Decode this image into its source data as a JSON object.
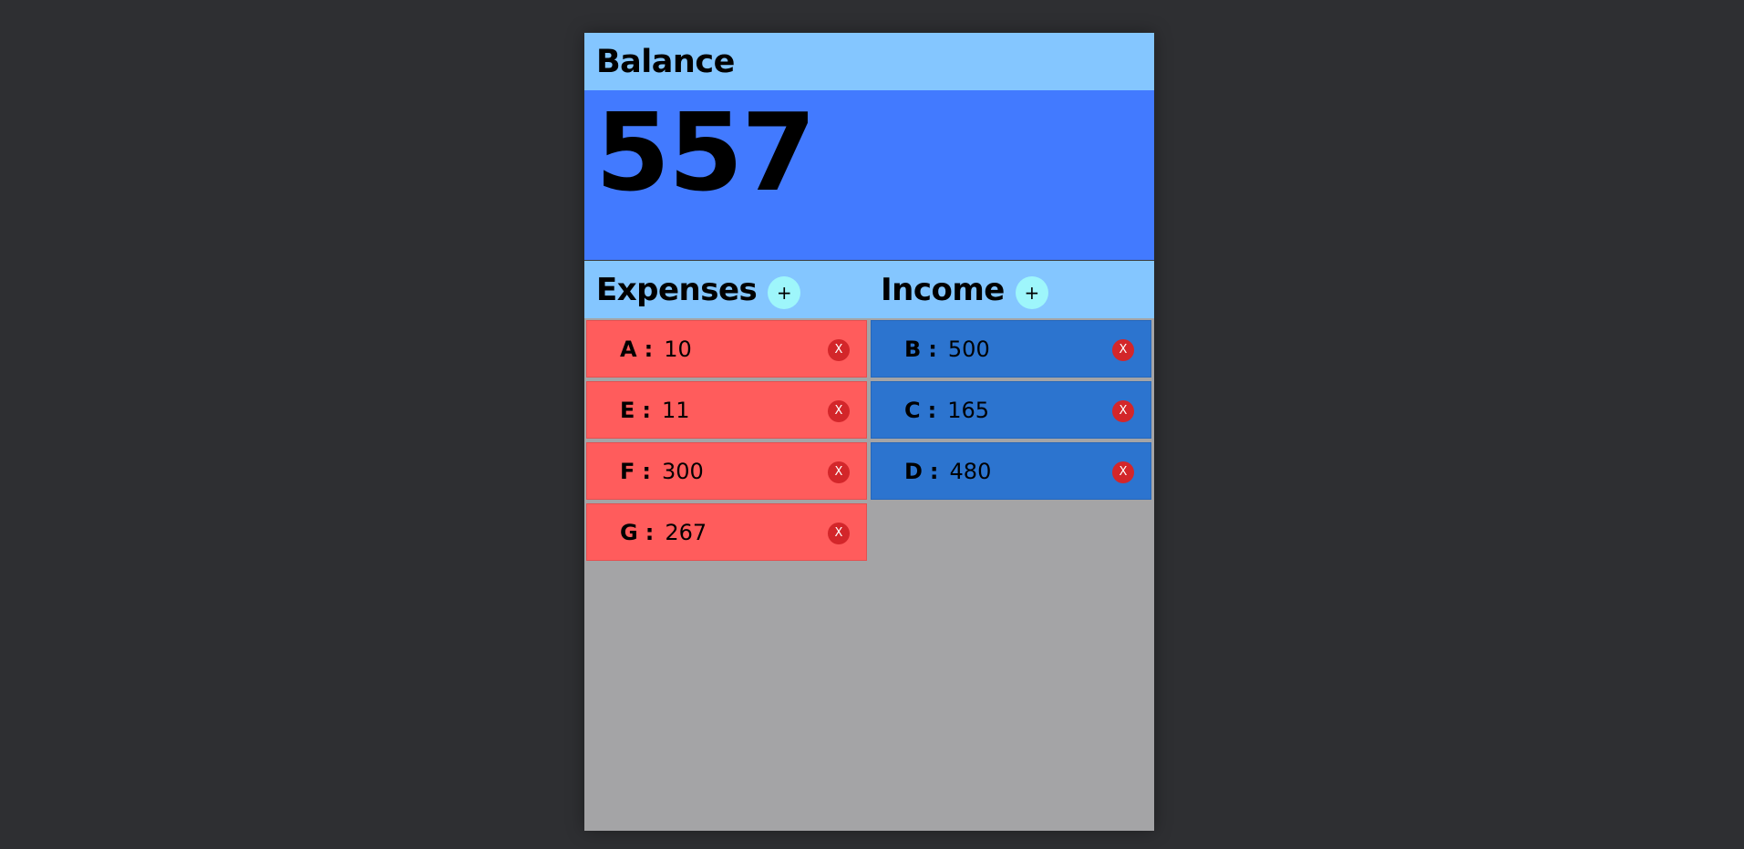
{
  "balance": {
    "title": "Balance",
    "amount": "557"
  },
  "expenses": {
    "title": "Expenses",
    "add_label": "+",
    "items": [
      {
        "name": "A",
        "sep": ":",
        "value": "10",
        "delete_label": "X"
      },
      {
        "name": "E",
        "sep": ":",
        "value": "11",
        "delete_label": "X"
      },
      {
        "name": "F",
        "sep": ":",
        "value": "300",
        "delete_label": "X"
      },
      {
        "name": "G",
        "sep": ":",
        "value": "267",
        "delete_label": "X"
      }
    ]
  },
  "income": {
    "title": "Income",
    "add_label": "+",
    "items": [
      {
        "name": "B",
        "sep": ":",
        "value": "500",
        "delete_label": "X"
      },
      {
        "name": "C",
        "sep": ":",
        "value": "165",
        "delete_label": "X"
      },
      {
        "name": "D",
        "sep": ":",
        "value": "480",
        "delete_label": "X"
      }
    ]
  },
  "colors": {
    "background": "#2e2f32",
    "header": "#84c6ff",
    "balance_panel": "#427aff",
    "expense_item": "#ff5c5c",
    "income_item": "#2c74cf",
    "add_button": "#9ef6fb",
    "delete_button": "#d3262a",
    "empty_area": "#a4a4a6"
  }
}
